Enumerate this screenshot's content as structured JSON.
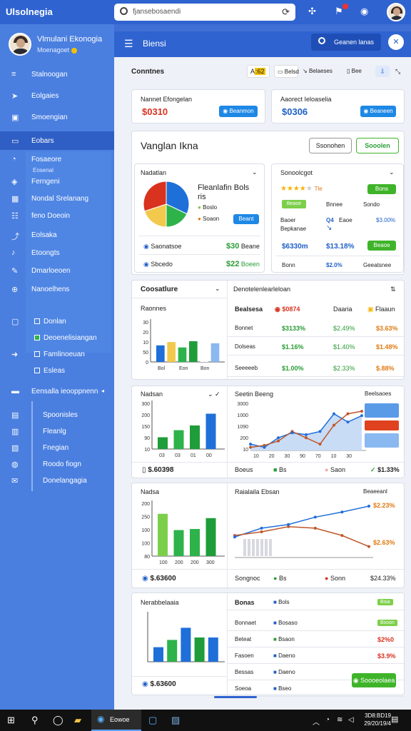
{
  "topbar": {
    "app_name": "Ulsolnegia",
    "search_value": "fjansebosaendi",
    "icons": [
      "search-icon",
      "refresh-icon",
      "puzzle-icon",
      "bell-icon",
      "settings-icon",
      "avatar"
    ]
  },
  "sidebar": {
    "profile_name": "Vlmulani Ekonogia",
    "profile_sub": "Moenagoet",
    "items": [
      {
        "label": "Stalnoogan",
        "icon": "hamburger-icon"
      },
      {
        "label": "Eolgaies",
        "icon": "send-icon"
      },
      {
        "label": "Smoengian",
        "icon": "calendar-icon"
      },
      {
        "label": "Eobars",
        "icon": "chat-icon",
        "active": true
      },
      {
        "label": "Fosaeore",
        "icon": "clock-icon"
      },
      {
        "label": "Eosenal",
        "icon": "user-icon"
      },
      {
        "label": "Ferngeni",
        "icon": "tag-icon"
      },
      {
        "label": "Nondal Srelanang",
        "icon": "grid-icon"
      },
      {
        "label": "feno Doeoin",
        "icon": "list-icon"
      },
      {
        "label": "Eolsaka",
        "icon": "share-icon"
      },
      {
        "label": "Etoongts",
        "icon": "twitter-icon"
      },
      {
        "label": "Dmarloeoen",
        "icon": "edit-icon"
      },
      {
        "label": "Nanoelhens",
        "icon": "globe-icon"
      }
    ],
    "group1": [
      {
        "label": "Donlan",
        "checked": false,
        "icon": "window-icon"
      },
      {
        "label": "Deoenelisiangan",
        "checked": true
      },
      {
        "label": "Famlinoeuan",
        "checked": false,
        "icon": "arrow-icon"
      },
      {
        "label": "Esleas",
        "checked": false
      }
    ],
    "group2_title": "Eensalla ieooppnenn",
    "group2": [
      {
        "label": "Spoonisles"
      },
      {
        "label": "Fleanlg"
      },
      {
        "label": "Fnegian"
      },
      {
        "label": "Roodo fiogn"
      },
      {
        "label": "Donelangagia"
      }
    ]
  },
  "main": {
    "title": "Biensi",
    "top_button": "Geanen lanas",
    "section_title": "Conntnes",
    "toolbar": [
      "A",
      ":62",
      "Belsd",
      "Belaeses",
      "Bee"
    ],
    "kpi": [
      {
        "title": "Nannet Efongelan",
        "value": "$0310",
        "button": "Beanmon"
      },
      {
        "title": "Aaorect Ieloaselia",
        "value": "$0306",
        "button": "Beaneen"
      }
    ],
    "panel_title": "Vanglan Ikna",
    "panel_btn1": "Ssonohen",
    "panel_btn2": "Sooolen",
    "left_panel": {
      "title": "Nadatlan",
      "legend_title": "Fleanlafin Bols",
      "legend_sub": "ris",
      "legend": [
        "Boslo",
        "Soaon"
      ],
      "legend_button": "Beant",
      "pie": [
        32,
        18,
        20,
        30
      ],
      "rows": [
        {
          "label": "Saonatsoe",
          "value": "$30",
          "unit": "Beane"
        },
        {
          "label": "Sbcedo",
          "value": "$22",
          "unit": "Boeen"
        }
      ]
    },
    "right_panel": {
      "title": "Sonoolcgot",
      "rating_label": "Tle",
      "rating_stars": 4,
      "tag1": "Bons",
      "tag2": "Beaoe",
      "links": [
        "Bnnee",
        "Sondo"
      ],
      "row1": [
        "Baoer",
        "Q4",
        "Eaoe",
        "$3.00%"
      ],
      "row2": [
        "Bepkanae"
      ],
      "button": "Beaoe",
      "row3": [
        "$6330m",
        "$13.18%"
      ],
      "row4": [
        "Bonn",
        "$2.0%",
        "Geeatsnee"
      ]
    },
    "card3": {
      "title": "Coosatlure",
      "bar_title": "Raonnes",
      "bars": [
        40,
        48,
        35,
        50,
        30,
        45
      ],
      "y_ticks": [
        "30",
        "20",
        "10",
        "50",
        "0"
      ],
      "x_ticks": [
        "Bol",
        "Eon",
        "Bon"
      ],
      "right_title": "Denotelenlearleloan",
      "header": [
        "Bealsesa",
        "$0874",
        "Daaria",
        "Flaaun"
      ],
      "rows": [
        {
          "label": "Bonnet",
          "c1": "$3133%",
          "c2": "$2.49%",
          "c3": "$3.63%"
        },
        {
          "label": "Dolseas",
          "c1": "$1.16%",
          "c2": "$1.40%",
          "c3": "$1.48%"
        },
        {
          "label": "Seeeeeb",
          "c1": "$1.00%",
          "c2": "$2.33%",
          "c3": "$.88%"
        }
      ]
    },
    "card4": {
      "title": "Nadsan",
      "y_ticks": [
        "300",
        "200",
        "150",
        "90",
        "10"
      ],
      "x_ticks": [
        "03",
        "03",
        "01",
        "00"
      ],
      "bars": [
        25,
        40,
        50,
        75
      ],
      "left_value": "$.60398",
      "right_title": "Seetin Beeng",
      "right_badge": "Beelsaoes",
      "y2_ticks": [
        "3000",
        "1000",
        "1090",
        "200",
        "10"
      ],
      "x2_ticks": [
        "10",
        "20",
        "30",
        "90",
        "70",
        "10",
        "30"
      ],
      "line1": [
        5,
        8,
        15,
        30,
        20,
        10,
        40,
        58,
        62
      ],
      "line2": [
        10,
        5,
        20,
        28,
        25,
        30,
        58,
        45,
        55
      ],
      "legend": [
        "Boeus",
        "Bs",
        "Saon"
      ],
      "legend_value": "$1.33%",
      "side_tags": [
        "tag-blue",
        "tag-red",
        "tag-blue"
      ]
    },
    "card5": {
      "title": "Nadsa",
      "y_ticks": [
        "200",
        "250",
        "100",
        "100",
        "80"
      ],
      "x_ticks": [
        "100",
        "200",
        "200",
        "300"
      ],
      "bars": [
        78,
        48,
        50,
        70
      ],
      "left_value": "$.63600",
      "right_title": "Raialaila Ebsan",
      "right_badge": "Beaeeanl",
      "line1": [
        28,
        40,
        45,
        55,
        62,
        70
      ],
      "line2": [
        30,
        35,
        42,
        40,
        30,
        15
      ],
      "right_values": [
        "$2.23%",
        "$2.63%"
      ],
      "legend": [
        "Songnoc",
        "Bs",
        "Sonn"
      ],
      "legend_value": "$24.33%"
    },
    "card6": {
      "title": "Nerabbelaaia",
      "bars": [
        30,
        45,
        70,
        50,
        50
      ],
      "left_value": "$.63600",
      "right_title": "Bonas",
      "rows": [
        {
          "label": "Dooeoe",
          "chip": "Bols",
          "tag": "Bsia",
          "tagtype": "green"
        },
        {
          "label": "Bonnaet",
          "chip": "Bosaso",
          "tag": "Bsoon",
          "tagtype": "green"
        },
        {
          "label": "Beteat",
          "chip": "Bsaon",
          "tag": "$2%0",
          "tagtype": "red"
        },
        {
          "label": "Fasoen",
          "chip": "Daeno",
          "tag": "$3.9%",
          "tagtype": "red"
        },
        {
          "label": "Bessas",
          "chip": "Daeno",
          "tag": "",
          "tagtype": "none"
        },
        {
          "label": "Soeoa",
          "chip": "Bseo",
          "tag": "",
          "tagtype": "none"
        }
      ],
      "button": "Soooeolaea"
    }
  },
  "taskbar": {
    "app_label": "Eowoe",
    "time": "3D8:BD19",
    "date": "29/20/19/4"
  },
  "colors": {
    "sidebar": "#4a7fe0",
    "topbar": "#2f63d0",
    "green": "#2a9d35",
    "red": "#d9321f",
    "blue": "#1f5fc8"
  }
}
